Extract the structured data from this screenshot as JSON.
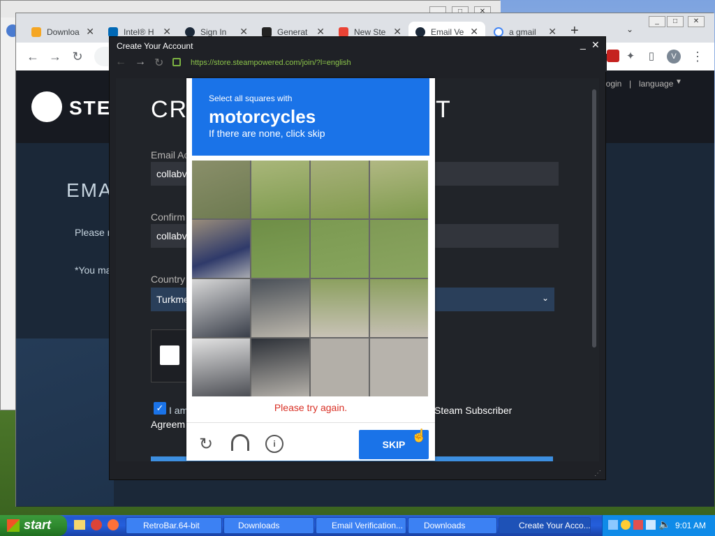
{
  "taskbar": {
    "start_label": "start",
    "tasks": [
      {
        "label": "RetroBar.64-bit"
      },
      {
        "label": "Downloads"
      },
      {
        "label": "Email Verification..."
      },
      {
        "label": "Downloads"
      },
      {
        "label": "Create Your Acco..."
      }
    ],
    "clock": "9:01 AM"
  },
  "browser": {
    "tabs": [
      {
        "label": "Downloa"
      },
      {
        "label": "Intel® H"
      },
      {
        "label": "Sign In"
      },
      {
        "label": "Generat"
      },
      {
        "label": "New Ste"
      },
      {
        "label": "Email Ve"
      },
      {
        "label": "a gmail"
      }
    ],
    "new_tab": "+",
    "profile_initial": "V"
  },
  "steam_page": {
    "logo_text": "STEA",
    "login_link": "login",
    "separator": "|",
    "language": "language",
    "heading_partial": "EMA",
    "please_partial": "Please r",
    "you_partial": "*You ma"
  },
  "popup": {
    "title": "Create Your Account",
    "url": "https://store.steampowered.com/join/?l=english",
    "heading_left": "CRI",
    "heading_right": "T",
    "email_label": "Email Ac",
    "email_value": "collabvi",
    "confirm_label": "Confirm",
    "confirm_value": "collabvi",
    "country_label": "Country",
    "country_value": "Turkme",
    "agree_partial": "I am",
    "agree_tail": "Steam Subscriber",
    "agreement_partial": "Agreem"
  },
  "captcha": {
    "instruction": "Select all squares with",
    "target": "motorcycles",
    "hint": "If there are none, click skip",
    "error": "Please try again.",
    "skip_label": "SKIP"
  }
}
